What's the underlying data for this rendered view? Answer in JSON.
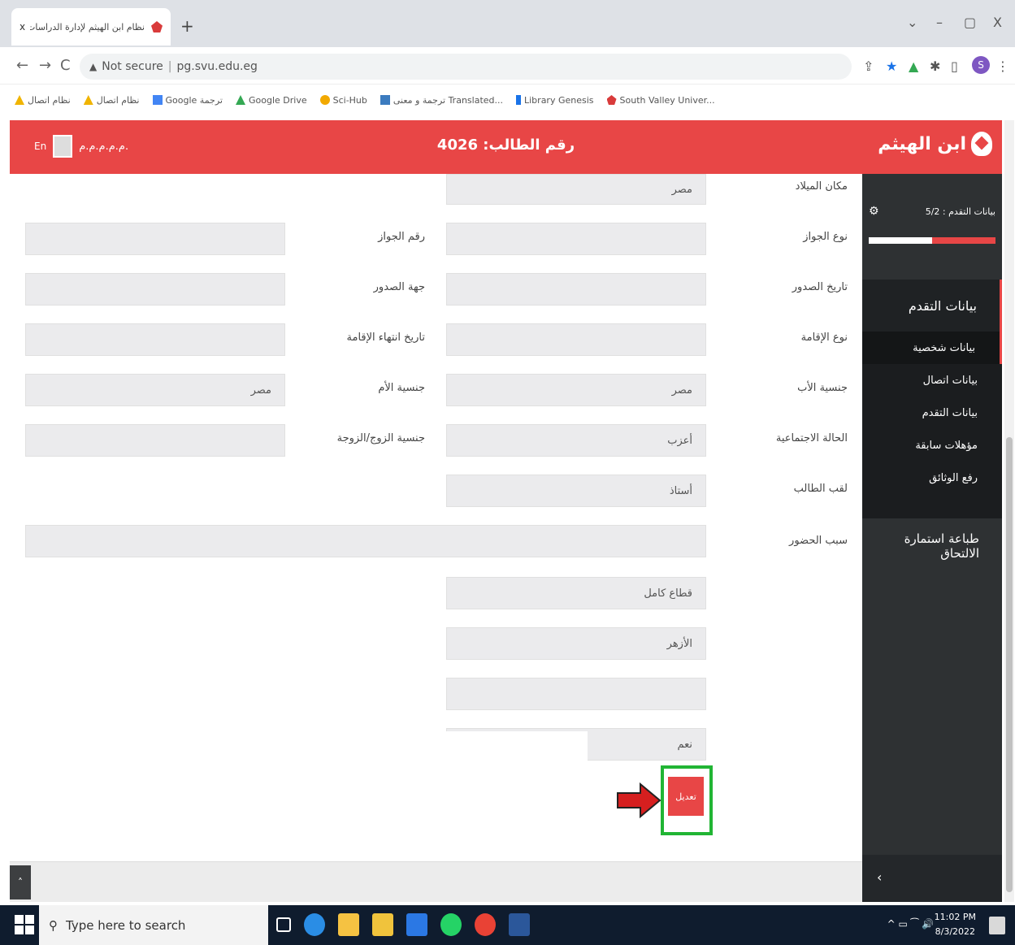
{
  "browser": {
    "tab_title": "نظام ابن الهيثم لإدارة الدراسات العـ",
    "tab_close": "x",
    "new_tab": "+",
    "window_controls": [
      "⌄",
      "–",
      "▢",
      "X"
    ],
    "nav": {
      "back": "←",
      "forward": "→",
      "reload": "C"
    },
    "security_label": "Not secure",
    "url": "pg.svu.edu.eg",
    "profile_initial": "S",
    "bookmarks": [
      {
        "label": "نظام اتصال",
        "icon": "drive-icon",
        "color": "#f0b400"
      },
      {
        "label": "نظام اتصال",
        "icon": "drive-icon",
        "color": "#f0b400"
      },
      {
        "label": "Google ترجمة",
        "icon": "translate-icon",
        "color": "#4285f4"
      },
      {
        "label": "Google Drive",
        "icon": "drive-icon",
        "color": "#34a853"
      },
      {
        "label": "Sci-Hub",
        "icon": "scihub-icon",
        "color": "#f2a900"
      },
      {
        "label": "ترجمة و معنى Translated...",
        "icon": "translate-icon",
        "color": "#3b7bbf"
      },
      {
        "label": "Library Genesis",
        "icon": "book-icon",
        "color": "#1a73e8"
      },
      {
        "label": "South Valley Univer...",
        "icon": "university-icon",
        "color": "#d93b3b"
      }
    ]
  },
  "header": {
    "logo_text": "ابن الهيثم",
    "student_number": "رقم الطالب: 4026",
    "user_name": "م.م.م.م.م.",
    "lang": "En"
  },
  "sidebar": {
    "progress_label": "بيانات التقدم : 5/2",
    "progress_fraction": 0.5,
    "section": "بيانات التقدم",
    "sub_items": [
      "بيانات شخصية",
      "بيانات اتصال",
      "بيانات التقدم",
      "مؤهلات سابقة",
      "رفع الوثائق"
    ],
    "print_label": "طباعة استمارة الالتحاق",
    "chevron": "›"
  },
  "form": {
    "right_labels": [
      "مكان الميلاد",
      "نوع الجواز",
      "تاريخ الصدور",
      "نوع الإقامة",
      "جنسية الأب",
      "الحالة الاجتماعية",
      "لقب الطالب",
      "سبب الحضور"
    ],
    "right_values": [
      "مصر",
      "",
      "",
      "",
      "مصر",
      "أعزب",
      "أستاذ"
    ],
    "left_labels": [
      "رقم الجواز",
      "جهة الصدور",
      "تاريخ انتهاء الإقامة",
      "جنسية الأم",
      "جنسية الزوج/الزوجة"
    ],
    "left_values": [
      "",
      "",
      "",
      "مصر",
      ""
    ],
    "extra_values": [
      "قطاع كامل",
      "الأزهر",
      "",
      "نعم"
    ],
    "save_label": "تعديل"
  },
  "taskbar": {
    "search_placeholder": "Type here to search",
    "time": "11:02 PM",
    "date": "8/3/2022",
    "tray": "^ ▭ ⁀ 🔊",
    "pinned_icons": [
      {
        "name": "task-view-icon",
        "color": "#ffffff"
      },
      {
        "name": "edge-icon",
        "color": "#2a8de5"
      },
      {
        "name": "store-icon",
        "color": "#f5c242"
      },
      {
        "name": "explorer-icon",
        "color": "#f0c33c"
      },
      {
        "name": "mail-icon",
        "color": "#2b78e4"
      },
      {
        "name": "whatsapp-icon",
        "color": "#25d366"
      },
      {
        "name": "chrome-icon",
        "color": "#e94235"
      },
      {
        "name": "word-icon",
        "color": "#2b579a"
      }
    ]
  },
  "colors": {
    "accent": "#e84646",
    "sidebar": "#2e3133",
    "highlight": "#21b534",
    "arrow": "#d61f1f"
  }
}
